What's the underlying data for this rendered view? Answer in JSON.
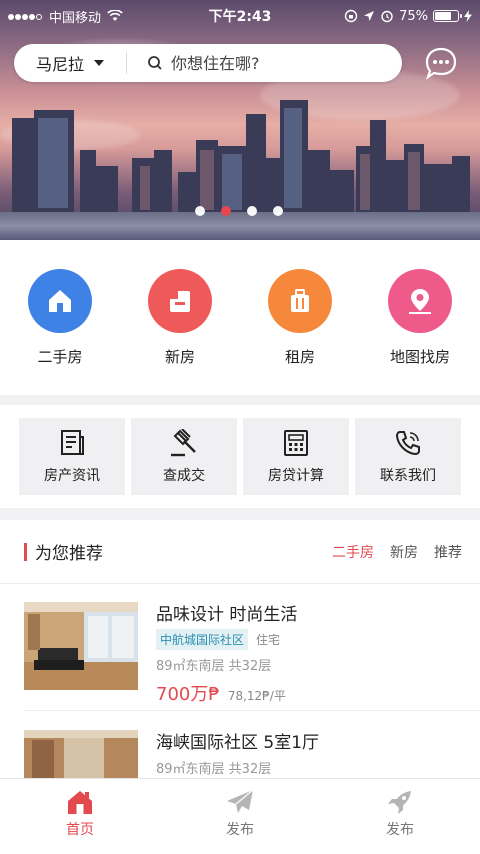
{
  "status_bar": {
    "carrier": "中国移动",
    "time": "下午2:43",
    "battery_percent": "75%",
    "battery_level": 0.75
  },
  "search": {
    "city": "马尼拉",
    "placeholder": "你想住在哪?"
  },
  "banner": {
    "slide_count": 4,
    "active_slide": 1
  },
  "categories": [
    {
      "label": "二手房",
      "icon": "house-icon",
      "color": "#3f82e6"
    },
    {
      "label": "新房",
      "icon": "new-building-icon",
      "color": "#ee5a5a"
    },
    {
      "label": "租房",
      "icon": "luggage-icon",
      "color": "#f5883a"
    },
    {
      "label": "地图找房",
      "icon": "map-pin-icon",
      "color": "#ee5b8a"
    }
  ],
  "tools": [
    {
      "label": "房产资讯",
      "icon": "news-icon"
    },
    {
      "label": "查成交",
      "icon": "gavel-icon"
    },
    {
      "label": "房贷计算",
      "icon": "calculator-icon"
    },
    {
      "label": "联系我们",
      "icon": "phone-icon"
    }
  ],
  "recommend": {
    "title": "为您推荐",
    "tabs": [
      {
        "label": "二手房",
        "active": true
      },
      {
        "label": "新房",
        "active": false
      },
      {
        "label": "推荐",
        "active": false
      }
    ],
    "listings": [
      {
        "title": "品味设计 时尚生活",
        "community": "中航城国际社区",
        "type": "住宅",
        "meta": "89㎡东南层  共32层",
        "price": "700万₱",
        "unit_price": "78,12₱/平"
      },
      {
        "title": "海峡国际社区  5室1厅",
        "meta": "89㎡东南层  共32层"
      }
    ]
  },
  "tab_bar": [
    {
      "label": "首页",
      "icon": "home-icon",
      "active": true
    },
    {
      "label": "发布",
      "icon": "paper-plane-icon",
      "active": false
    },
    {
      "label": "发布",
      "icon": "rocket-icon",
      "active": false
    }
  ],
  "colors": {
    "accent": "#e24a4e",
    "tag_bg": "#e3f1f5",
    "tag_text": "#2d8fb0"
  }
}
